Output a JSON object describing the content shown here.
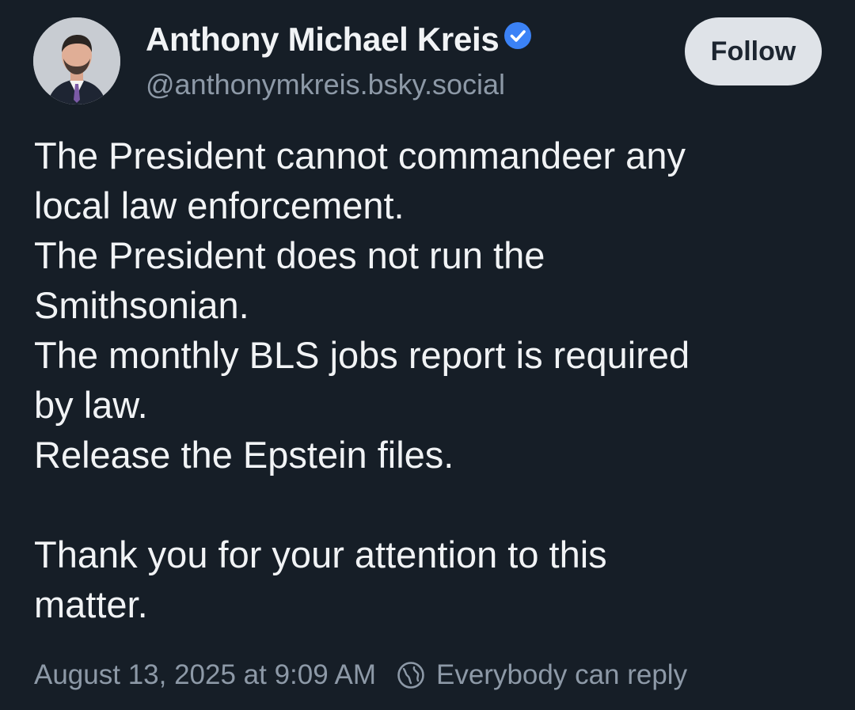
{
  "author": {
    "display_name": "Anthony Michael Kreis",
    "handle": "@anthonymkreis.bsky.social",
    "verified": true,
    "avatar_icon": "profile-photo"
  },
  "follow_button": {
    "label": "Follow"
  },
  "post": {
    "lines": [
      "The President cannot commandeer any",
      "local law enforcement.",
      "The President does not run the",
      "Smithsonian.",
      "The monthly BLS jobs report is required",
      "by law.",
      "Release the Epstein files.",
      "",
      "Thank you for your attention to this",
      "matter."
    ]
  },
  "meta": {
    "timestamp": "August 13, 2025 at 9:09 AM",
    "reply_setting": "Everybody can reply",
    "reply_icon": "globe-icon"
  },
  "colors": {
    "background": "#161e27",
    "text": "#f1f3f5",
    "muted": "#8d99a7",
    "verified_blue": "#3b82f6",
    "follow_bg": "#dfe3e8"
  }
}
